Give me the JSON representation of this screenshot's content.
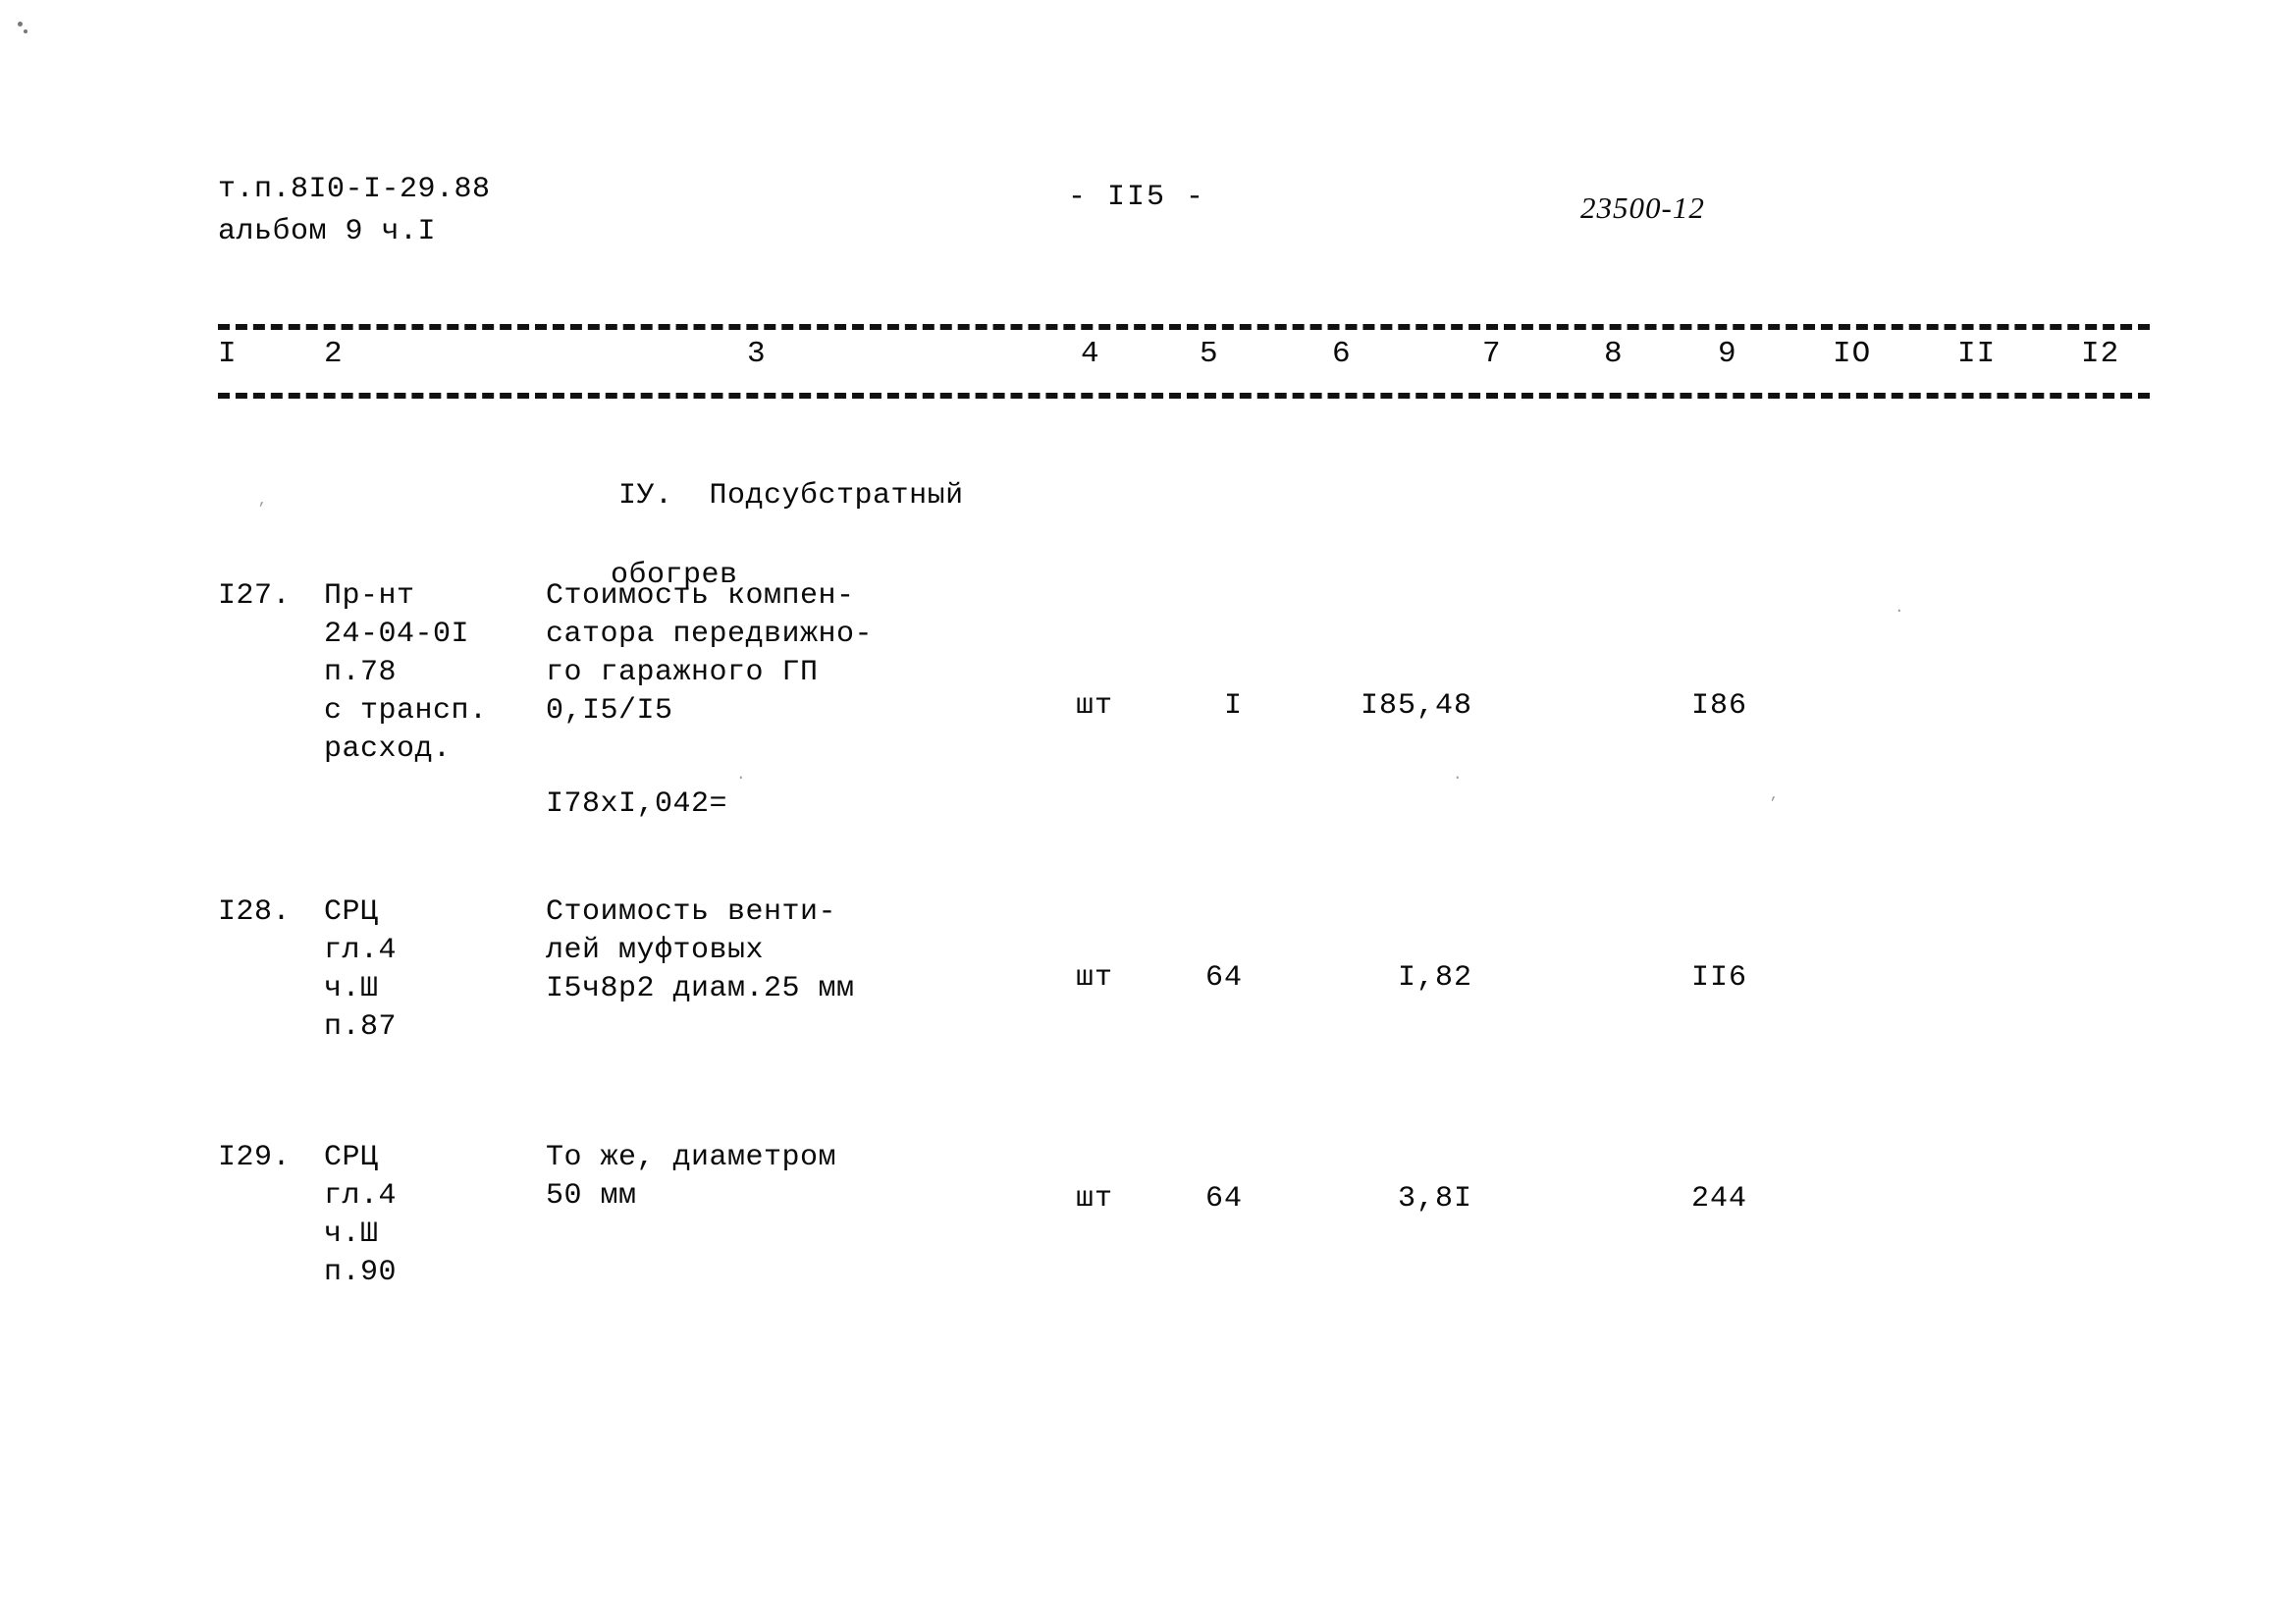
{
  "header": {
    "doc_ref_line1": "т.п.8I0-I-29.88",
    "doc_ref_line2": "альбом 9 ч.I",
    "page_number": "- II5 -",
    "doc_code": "23500-12"
  },
  "table": {
    "column_numbers": [
      "I",
      "2",
      "3",
      "4",
      "5",
      "6",
      "7",
      "8",
      "9",
      "IO",
      "II",
      "I2"
    ],
    "section_heading": {
      "line1": "IУ.  Подсубстратный",
      "line2": "обогрев"
    },
    "rows": [
      {
        "number": "I27.",
        "justification": "Пр-нт\n24-04-0I\nп.78\nс трансп.\nрасход.",
        "description": "Стоимость компен-\nсатора передвижно-\nго гаражного ГП\n0,I5/I5",
        "unit": "шт",
        "quantity": "I",
        "unit_price": "I85,48",
        "total": "I86"
      },
      {
        "number": "I28.",
        "justification": "СРЦ\nгл.4\nч.Ш\nп.87",
        "description": "Стоимость венти-\nлей муфтовых\nI5ч8р2 диам.25 мм",
        "unit": "шт",
        "quantity": "64",
        "unit_price": "I,82",
        "total": "II6"
      },
      {
        "number": "I29.",
        "justification": "СРЦ\nгл.4\nч.Ш\nп.90",
        "description": "То же, диаметром\n50 мм",
        "unit": "шт",
        "quantity": "64",
        "unit_price": "3,8I",
        "total": "244"
      }
    ],
    "calculation_note": "I78xI,042="
  }
}
